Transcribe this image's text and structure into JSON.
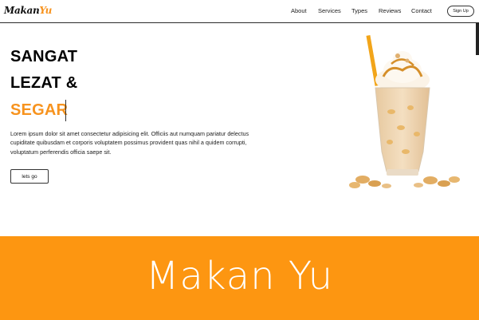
{
  "nav": {
    "logo_part1": "Makan",
    "logo_part2": "Yu",
    "items": [
      "About",
      "Services",
      "Types",
      "Reviews",
      "Contact"
    ],
    "signup_label": "Sign Up"
  },
  "hero": {
    "line1": "SANGAT",
    "line2": "LEZAT &",
    "line3": "SEGAR",
    "paragraph": "Lorem ipsum dolor sit amet consectetur adipisicing elit. Officiis aut numquam pariatur delectus cupiditate quibusdam et corporis voluptatem possimus provident quas nihil a quidem corrupti, voluptatum perferendis officia saepe sit.",
    "cta_label": "lets go"
  },
  "banner": {
    "title": "Makan Yu"
  },
  "colors": {
    "accent": "#f7931e",
    "banner": "#fd9611"
  }
}
